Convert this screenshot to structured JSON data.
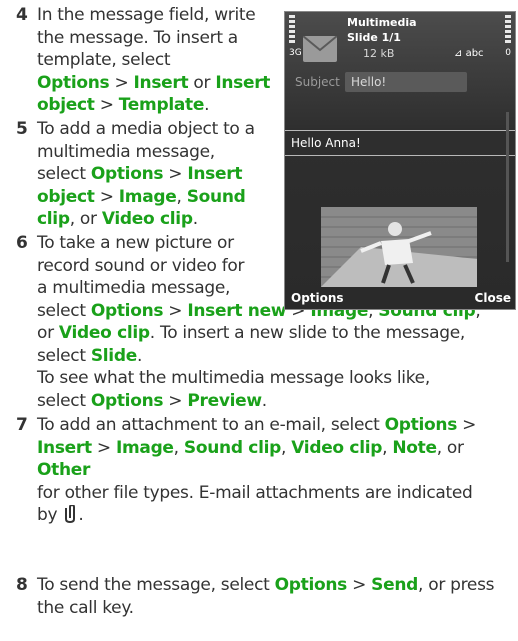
{
  "steps": [
    {
      "num": "4",
      "lines": [
        [
          {
            "t": "In the message field, write"
          }
        ],
        [
          {
            "t": "the message. To insert a"
          }
        ],
        [
          {
            "t": "template, select"
          }
        ],
        [
          {
            "t": "Options",
            "g": true
          },
          {
            "t": " > "
          },
          {
            "t": "Insert",
            "g": true
          },
          {
            "t": " or "
          },
          {
            "t": "Insert",
            "g": true
          }
        ],
        [
          {
            "t": "object",
            "g": true
          },
          {
            "t": " > "
          },
          {
            "t": "Template",
            "g": true
          },
          {
            "t": "."
          }
        ]
      ]
    },
    {
      "num": "5",
      "lines": [
        [
          {
            "t": "To add a media object to a"
          }
        ],
        [
          {
            "t": "multimedia message,"
          }
        ],
        [
          {
            "t": "select "
          },
          {
            "t": "Options",
            "g": true
          },
          {
            "t": " > "
          },
          {
            "t": "Insert",
            "g": true
          }
        ],
        [
          {
            "t": "object",
            "g": true
          },
          {
            "t": " > "
          },
          {
            "t": "Image",
            "g": true
          },
          {
            "t": ", "
          },
          {
            "t": "Sound",
            "g": true
          }
        ],
        [
          {
            "t": "clip",
            "g": true
          },
          {
            "t": ", or "
          },
          {
            "t": "Video clip",
            "g": true
          },
          {
            "t": "."
          }
        ]
      ]
    },
    {
      "num": "6",
      "lines": [
        [
          {
            "t": "To take a new picture or"
          }
        ],
        [
          {
            "t": "record sound or video for"
          }
        ],
        [
          {
            "t": "a multimedia message,"
          }
        ],
        [
          {
            "t": "select "
          },
          {
            "t": "Options",
            "g": true
          },
          {
            "t": " > "
          },
          {
            "t": "Insert new",
            "g": true
          },
          {
            "t": " > "
          },
          {
            "t": "Image",
            "g": true
          },
          {
            "t": ", "
          },
          {
            "t": "Sound clip",
            "g": true
          },
          {
            "t": ","
          }
        ],
        [
          {
            "t": "or "
          },
          {
            "t": "Video clip",
            "g": true
          },
          {
            "t": ". To insert a new slide to the message,"
          }
        ],
        [
          {
            "t": "select "
          },
          {
            "t": "Slide",
            "g": true
          },
          {
            "t": "."
          }
        ],
        [
          {
            "t": "To see what the multimedia message looks like,"
          }
        ],
        [
          {
            "t": "select "
          },
          {
            "t": "Options",
            "g": true
          },
          {
            "t": " > "
          },
          {
            "t": "Preview",
            "g": true
          },
          {
            "t": "."
          }
        ]
      ]
    },
    {
      "num": "7",
      "lines": [
        [
          {
            "t": "To add an attachment to an e-mail, select "
          },
          {
            "t": "Options",
            "g": true
          },
          {
            "t": " >"
          }
        ],
        [
          {
            "t": "Insert",
            "g": true
          },
          {
            "t": " > "
          },
          {
            "t": "Image",
            "g": true
          },
          {
            "t": ", "
          },
          {
            "t": "Sound clip",
            "g": true
          },
          {
            "t": ", "
          },
          {
            "t": "Video clip",
            "g": true
          },
          {
            "t": ", "
          },
          {
            "t": "Note",
            "g": true
          },
          {
            "t": ", or "
          },
          {
            "t": "Other",
            "g": true
          }
        ],
        [
          {
            "t": "for other file types. E-mail attachments are indicated"
          }
        ],
        [
          {
            "t": "by "
          },
          {
            "icon": "paperclip-icon"
          },
          {
            "t": "."
          }
        ]
      ]
    },
    {
      "num": "8",
      "lines": [
        [
          {
            "t": "To send the message, select "
          },
          {
            "t": "Options",
            "g": true
          },
          {
            "t": " > "
          },
          {
            "t": "Send",
            "g": true
          },
          {
            "t": ", or press"
          }
        ],
        [
          {
            "t": "the call key."
          }
        ]
      ]
    }
  ],
  "phone": {
    "title": "Multimedia",
    "slide": "Slide 1/1",
    "size": "12 kB",
    "input_mode": "abc",
    "network": "3G",
    "battery_level": "0",
    "subject_label": "Subject",
    "subject_value": "Hello!",
    "body_text": "Hello Anna!",
    "left_softkey": "Options",
    "right_softkey": "Close"
  },
  "colors": {
    "text": "#333333",
    "link_green": "#1aa11a",
    "screen_bg": "#2e2e2e"
  }
}
